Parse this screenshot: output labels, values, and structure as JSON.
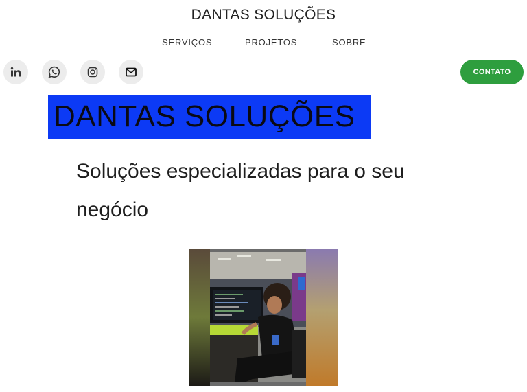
{
  "header": {
    "site_title": "DANTAS SOLUÇÕES",
    "nav": [
      {
        "label": "SERVIÇOS"
      },
      {
        "label": "PROJETOS"
      },
      {
        "label": "SOBRE"
      }
    ]
  },
  "social": [
    {
      "icon": "linkedin-icon"
    },
    {
      "icon": "whatsapp-icon"
    },
    {
      "icon": "instagram-icon"
    },
    {
      "icon": "email-icon"
    }
  ],
  "contact_button": {
    "label": "CONTATO",
    "color": "#2e9e3e"
  },
  "hero": {
    "title": "DANTAS SOLUÇÕES",
    "title_bg": "#0c3af5",
    "subtitle": "Soluções especializadas para o seu negócio"
  }
}
